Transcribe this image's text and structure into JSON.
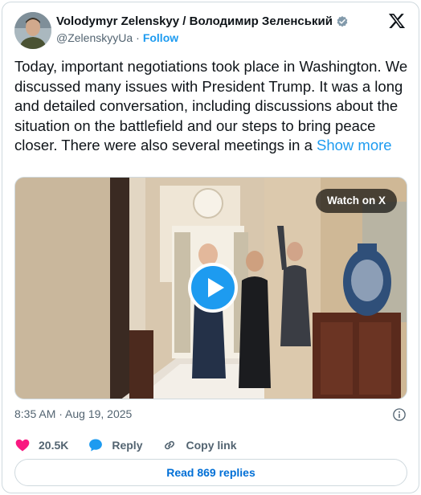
{
  "author": {
    "display_name": "Volodymyr Zelenskyy / Володимир Зеленський",
    "handle": "@ZelenskyyUa",
    "separator": "·",
    "follow_label": "Follow"
  },
  "tweet": {
    "text": "Today, important negotiations took place in Washington. We discussed many issues with President Trump. It was a long and detailed conversation, including discussions about the situation on the battlefield and our steps to bring peace closer. There were also several meetings in a ",
    "show_more_label": "Show more"
  },
  "media": {
    "watch_label": "Watch on X"
  },
  "timestamp": "8:35 AM · Aug 19, 2025",
  "actions": {
    "likes": "20.5K",
    "reply_label": "Reply",
    "copy_link_label": "Copy link"
  },
  "read_replies_label": "Read 869 replies",
  "colors": {
    "accent": "#1d9bf0",
    "like": "#f91880",
    "muted": "#536471",
    "link": "#006fd6"
  },
  "icons": {
    "verified": "verified-badge-icon",
    "logo": "x-logo-icon",
    "play": "play-icon",
    "info": "info-icon",
    "like": "heart-icon",
    "reply": "speech-bubble-icon",
    "copy_link": "link-icon"
  }
}
